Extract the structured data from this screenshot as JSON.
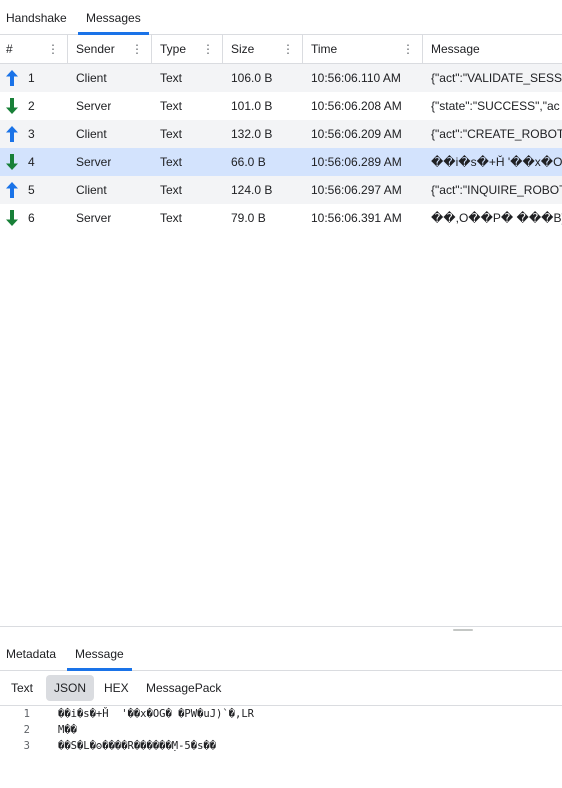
{
  "top_tabs": {
    "handshake": "Handshake",
    "messages": "Messages"
  },
  "table": {
    "headers": {
      "num": "#",
      "sender": "Sender",
      "type": "Type",
      "size": "Size",
      "time": "Time",
      "message": "Message"
    },
    "rows": [
      {
        "num": "1",
        "direction": "up",
        "sender": "Client",
        "type": "Text",
        "size": "106.0 B",
        "time": "10:56:06.110 AM",
        "message": "{\"act\":\"VALIDATE_SESS"
      },
      {
        "num": "2",
        "direction": "down",
        "sender": "Server",
        "type": "Text",
        "size": "101.0 B",
        "time": "10:56:06.208 AM",
        "message": "{\"state\":\"SUCCESS\",\"ac"
      },
      {
        "num": "3",
        "direction": "up",
        "sender": "Client",
        "type": "Text",
        "size": "132.0 B",
        "time": "10:56:06.209 AM",
        "message": "{\"act\":\"CREATE_ROBOT"
      },
      {
        "num": "4",
        "direction": "down",
        "sender": "Server",
        "type": "Text",
        "size": "66.0 B",
        "time": "10:56:06.289 AM",
        "message": "��i�s�+Ȟ '��x�OG"
      },
      {
        "num": "5",
        "direction": "up",
        "sender": "Client",
        "type": "Text",
        "size": "124.0 B",
        "time": "10:56:06.297 AM",
        "message": "{\"act\":\"INQUIRE_ROBOT"
      },
      {
        "num": "6",
        "direction": "down",
        "sender": "Server",
        "type": "Text",
        "size": "79.0 B",
        "time": "10:56:06.391 AM",
        "message": "��,O��P� ���B}"
      }
    ]
  },
  "bottom_tabs": {
    "metadata": "Metadata",
    "message": "Message"
  },
  "formats": {
    "text": "Text",
    "json": "JSON",
    "hex": "HEX",
    "messagepack": "MessagePack"
  },
  "code_lines": [
    {
      "n": "1",
      "text": "��i�s�+Ȟ  '��x�OG� �PW�uJ)`�,LR"
    },
    {
      "n": "2",
      "text": "M��"
    },
    {
      "n": "3",
      "text": "��S�L�ʘ����R������Ṃ-5�s��"
    }
  ],
  "colors": {
    "accent": "#1a73e8",
    "up_arrow": "#1a73e8",
    "down_arrow": "#188038",
    "selected_row": "#d3e3fd"
  },
  "icons": {
    "up": "arrow-up-icon",
    "down": "arrow-down-icon",
    "column_menu": "kebab-icon"
  }
}
